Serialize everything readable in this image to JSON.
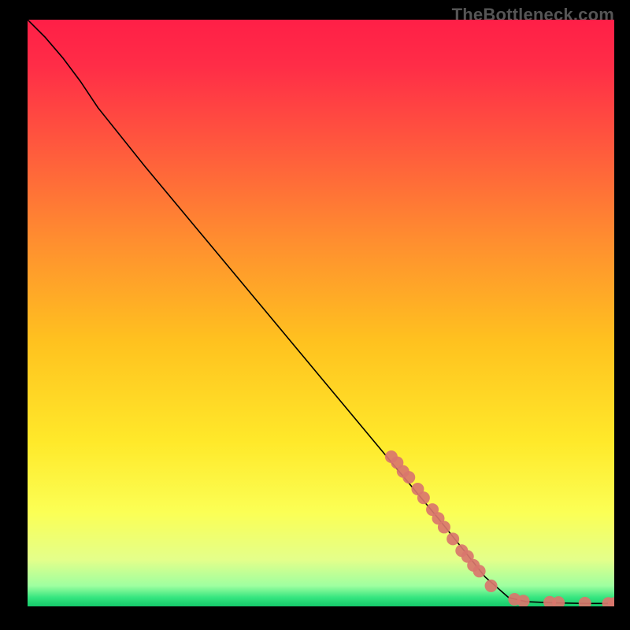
{
  "watermark": "TheBottleneck.com",
  "chart_data": {
    "type": "line",
    "title": "",
    "xlabel": "",
    "ylabel": "",
    "xlim": [
      0,
      100
    ],
    "ylim": [
      0,
      100
    ],
    "line": {
      "name": "curve",
      "color": "#000000",
      "points": [
        {
          "x": 0,
          "y": 100
        },
        {
          "x": 3,
          "y": 97
        },
        {
          "x": 6,
          "y": 93.5
        },
        {
          "x": 9,
          "y": 89.5
        },
        {
          "x": 12,
          "y": 85
        },
        {
          "x": 20,
          "y": 75
        },
        {
          "x": 30,
          "y": 63
        },
        {
          "x": 40,
          "y": 51
        },
        {
          "x": 50,
          "y": 39
        },
        {
          "x": 60,
          "y": 27
        },
        {
          "x": 70,
          "y": 15
        },
        {
          "x": 78,
          "y": 5
        },
        {
          "x": 82,
          "y": 1.5
        },
        {
          "x": 85,
          "y": 0.8
        },
        {
          "x": 90,
          "y": 0.6
        },
        {
          "x": 95,
          "y": 0.5
        },
        {
          "x": 100,
          "y": 0.5
        }
      ]
    },
    "scatter": {
      "name": "points",
      "color": "#d9766c",
      "radius": 8,
      "points": [
        {
          "x": 62,
          "y": 25.5
        },
        {
          "x": 63,
          "y": 24.5
        },
        {
          "x": 64,
          "y": 23
        },
        {
          "x": 65,
          "y": 22
        },
        {
          "x": 66.5,
          "y": 20
        },
        {
          "x": 67.5,
          "y": 18.5
        },
        {
          "x": 69,
          "y": 16.5
        },
        {
          "x": 70,
          "y": 15
        },
        {
          "x": 71,
          "y": 13.5
        },
        {
          "x": 72.5,
          "y": 11.5
        },
        {
          "x": 74,
          "y": 9.5
        },
        {
          "x": 75,
          "y": 8.5
        },
        {
          "x": 76,
          "y": 7
        },
        {
          "x": 77,
          "y": 6
        },
        {
          "x": 79,
          "y": 3.5
        },
        {
          "x": 83,
          "y": 1.2
        },
        {
          "x": 84.5,
          "y": 0.9
        },
        {
          "x": 89,
          "y": 0.7
        },
        {
          "x": 90.5,
          "y": 0.65
        },
        {
          "x": 95,
          "y": 0.55
        },
        {
          "x": 99,
          "y": 0.5
        },
        {
          "x": 100,
          "y": 0.5
        }
      ]
    },
    "gradient_stops": [
      {
        "offset": 0,
        "color": "#ff1f47"
      },
      {
        "offset": 0.08,
        "color": "#ff2d47"
      },
      {
        "offset": 0.22,
        "color": "#ff5a3d"
      },
      {
        "offset": 0.38,
        "color": "#ff8f2f"
      },
      {
        "offset": 0.55,
        "color": "#ffc21f"
      },
      {
        "offset": 0.72,
        "color": "#ffe92a"
      },
      {
        "offset": 0.84,
        "color": "#fbff55"
      },
      {
        "offset": 0.92,
        "color": "#e4ff8a"
      },
      {
        "offset": 0.965,
        "color": "#9effa0"
      },
      {
        "offset": 0.985,
        "color": "#35e57f"
      },
      {
        "offset": 1.0,
        "color": "#14c96a"
      }
    ]
  }
}
